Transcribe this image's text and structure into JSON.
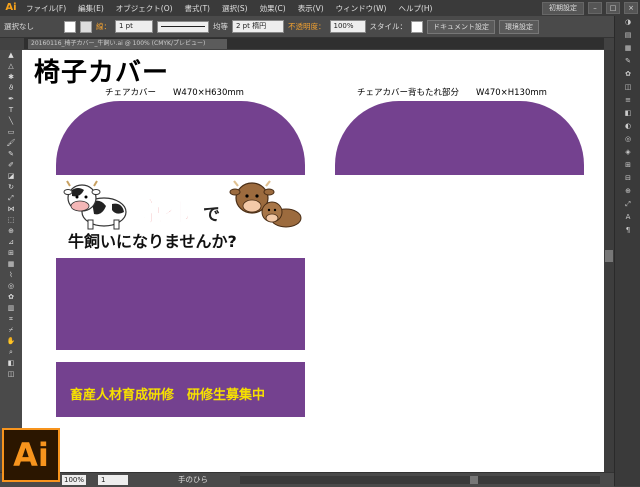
{
  "app": {
    "logo_small": "Ai",
    "logo_big": "Ai",
    "menu": [
      "ファイル(F)",
      "編集(E)",
      "オブジェクト(O)",
      "書式(T)",
      "選択(S)",
      "効果(C)",
      "表示(V)",
      "ウィンドウ(W)",
      "ヘルプ(H)"
    ],
    "workspace": "初期設定"
  },
  "controlbar": {
    "selection": "選択なし",
    "stroke_label": "線：",
    "stroke_weight": "1 pt",
    "stroke_profile": "均等",
    "brush": "2 pt 楕円",
    "opacity_label": "不透明度：",
    "opacity_value": "100%",
    "style_label": "スタイル：",
    "doc_settings": "ドキュメント設定",
    "prefs": "環境設定"
  },
  "tab": {
    "title": "20160116_椅子カバー_牛飼い.ai @ 100% (CMYK/プレビュー)"
  },
  "document": {
    "title": "椅子カバー",
    "label_left": "チェアカバー　　W470×H630mm",
    "label_right": "チェアカバー背もたれ部分　　W470×H130mm",
    "banner_kyoto": "京都",
    "banner_de": "で",
    "banner_tagline": "牛飼いになりませんか?",
    "recruit_text": "畜産人材育成研修　研修生募集中"
  },
  "statusbar": {
    "zoom": "100%",
    "page": "1",
    "tool": "手のひら"
  },
  "colors": {
    "purple": "#74418f",
    "ai_orange": "#f7941d",
    "red": "#d71920",
    "yellow": "#f6e000"
  }
}
